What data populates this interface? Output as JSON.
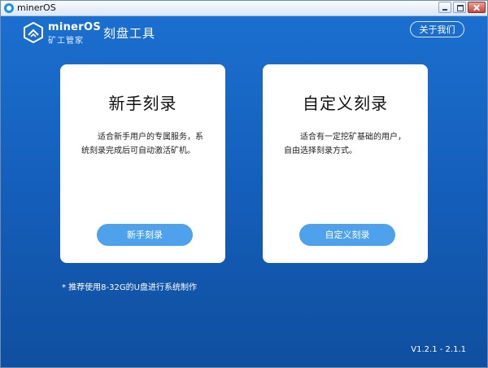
{
  "window": {
    "title": "minerOS"
  },
  "brand": {
    "name": "minerOS",
    "subtitle": "矿工管家"
  },
  "header": {
    "title": "刻盘工具",
    "about_label": "关于我们"
  },
  "cards": [
    {
      "title": "新手刻录",
      "description": "适合新手用户的专属服务，系统刻录完成后可自动激活矿机。",
      "button_label": "新手刻录"
    },
    {
      "title": "自定义刻录",
      "description": "适合有一定挖矿基础的用户，自由选择刻录方式。",
      "button_label": "自定义刻录"
    }
  ],
  "footer": {
    "tip": "* 推荐使用8-32G的U盘进行系统制作",
    "version": "V1.2.1 - 2.1.1"
  }
}
